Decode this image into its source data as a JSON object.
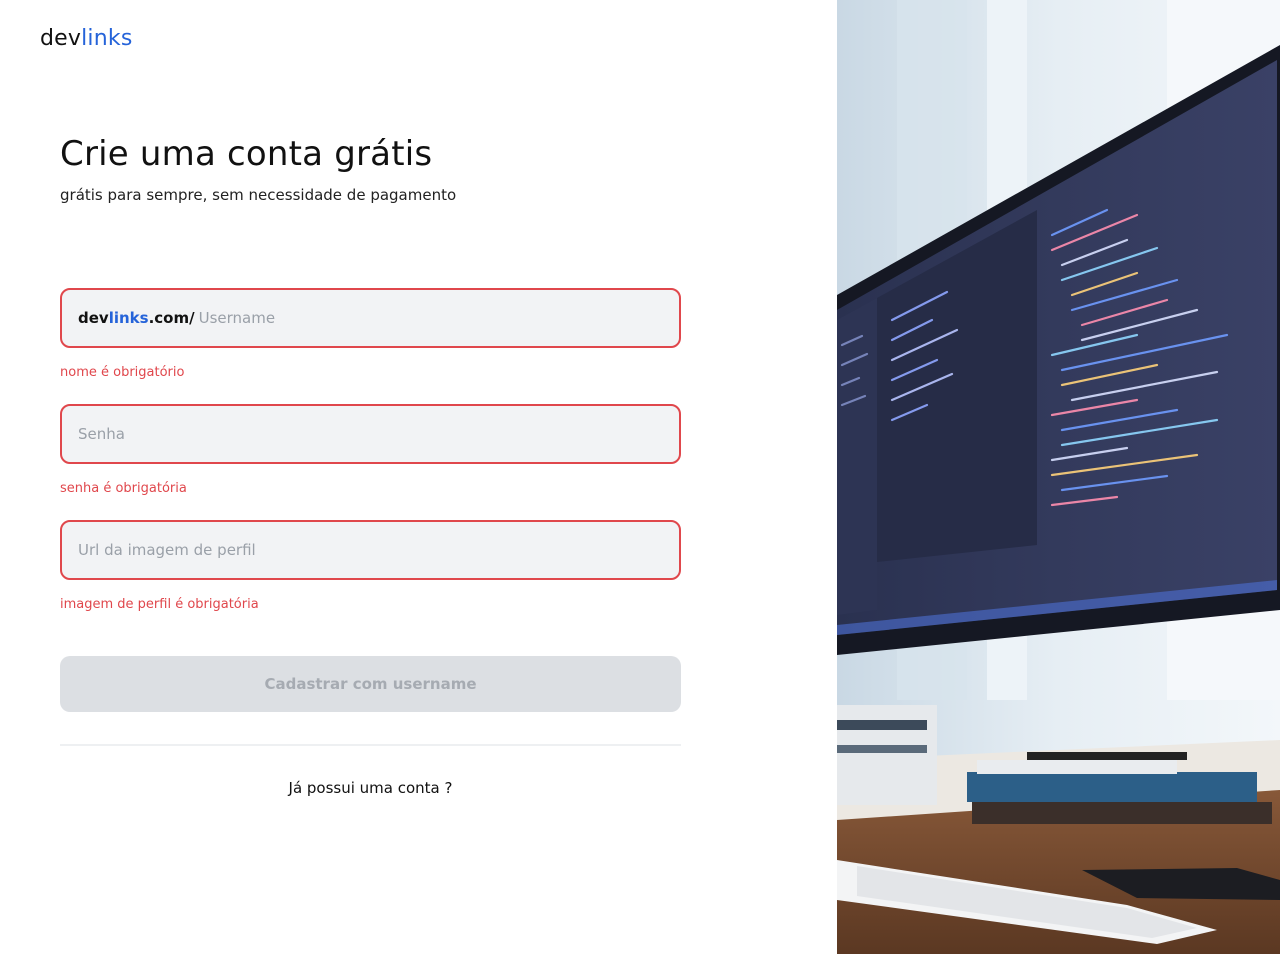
{
  "brand": {
    "logo_dev": "dev",
    "logo_links": "links"
  },
  "header": {
    "title": "Crie uma conta grátis",
    "subtitle": "grátis para sempre, sem necessidade de pagamento"
  },
  "form": {
    "username": {
      "prefix_dev": "dev",
      "prefix_links": "links",
      "prefix_suffix": ".com/",
      "placeholder": "Username",
      "value": "",
      "error": "nome é obrigatório"
    },
    "password": {
      "placeholder": "Senha",
      "value": "",
      "error": "senha é obrigatória"
    },
    "avatar_url": {
      "placeholder": "Url da imagem de perfil",
      "value": "",
      "error": "imagem de perfil é obrigatória"
    },
    "submit_label": "Cadastrar com username"
  },
  "footer": {
    "login_link": "Já possui uma conta ?"
  },
  "colors": {
    "accent": "#2563d9",
    "error": "#e0474c",
    "input_bg": "#f2f3f5",
    "button_disabled_bg": "#dcdfe3",
    "button_disabled_text": "#a6abb2"
  },
  "hero": {
    "image_description_icon": "monitor-code-photo"
  }
}
